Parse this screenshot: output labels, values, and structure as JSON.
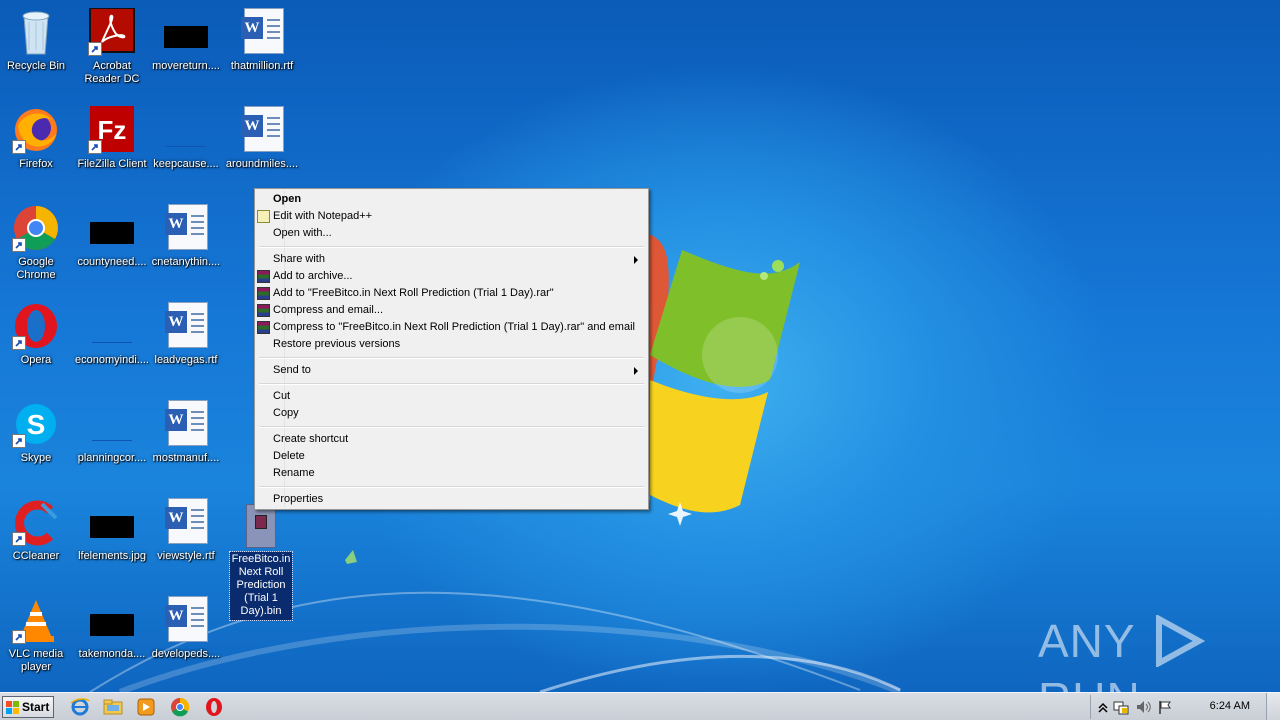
{
  "desktop": {
    "icons": [
      {
        "label": "Recycle Bin",
        "icon": "recycle-bin-icon"
      },
      {
        "label": "Acrobat\nReader DC",
        "icon": "acrobat-icon"
      },
      {
        "label": "movereturn....",
        "icon": "redacted-file-icon"
      },
      {
        "label": "thatmillion.rtf",
        "icon": "word-doc-icon"
      },
      {
        "label": "Firefox",
        "icon": "firefox-icon"
      },
      {
        "label": "FileZilla Client",
        "icon": "filezilla-icon"
      },
      {
        "label": "keepcause....",
        "icon": "blank-file-icon"
      },
      {
        "label": "aroundmiles....",
        "icon": "word-doc-icon"
      },
      {
        "label": "Google\nChrome",
        "icon": "chrome-icon"
      },
      {
        "label": "countyneed....",
        "icon": "redacted-file-icon"
      },
      {
        "label": "cnetanythin....",
        "icon": "word-doc-icon"
      },
      {
        "label": "Opera",
        "icon": "opera-icon"
      },
      {
        "label": "economyindi....",
        "icon": "blank-file-icon"
      },
      {
        "label": "leadvegas.rtf",
        "icon": "word-doc-icon"
      },
      {
        "label": "Skype",
        "icon": "skype-icon"
      },
      {
        "label": "planningcor....",
        "icon": "blank-file-icon"
      },
      {
        "label": "mostmanuf....",
        "icon": "word-doc-icon"
      },
      {
        "label": "CCleaner",
        "icon": "ccleaner-icon"
      },
      {
        "label": "lfelements.jpg",
        "icon": "redacted-file-icon"
      },
      {
        "label": "viewstyle.rtf",
        "icon": "word-doc-icon"
      },
      {
        "label": "VLC media\nplayer",
        "icon": "vlc-icon"
      },
      {
        "label": "takemonda....",
        "icon": "redacted-file-icon"
      },
      {
        "label": "developeds....",
        "icon": "word-doc-icon"
      }
    ],
    "selected_file": {
      "label": "FreeBitco.in\nNext Roll\nPrediction\n(Trial 1\nDay).bin",
      "icon": "bin-file-icon"
    }
  },
  "context_menu": {
    "open": "Open",
    "edit_notepad": "Edit with Notepad++",
    "open_with": "Open with...",
    "share_with": "Share with",
    "add_archive": "Add to archive...",
    "add_to_rar": "Add to \"FreeBitco.in Next Roll Prediction (Trial 1 Day).rar\"",
    "compress_email": "Compress and email...",
    "compress_rar_email": "Compress to \"FreeBitco.in Next Roll Prediction (Trial 1 Day).rar\" and email",
    "restore_versions": "Restore previous versions",
    "send_to": "Send to",
    "cut": "Cut",
    "copy": "Copy",
    "create_shortcut": "Create shortcut",
    "delete": "Delete",
    "rename": "Rename",
    "properties": "Properties"
  },
  "taskbar": {
    "start_label": "Start",
    "apps": [
      "internet-explorer-icon",
      "explorer-folder-icon",
      "media-player-icon",
      "chrome-icon",
      "opera-icon"
    ],
    "clock": "6:24 AM"
  },
  "watermark": {
    "left": "ANY",
    "right": "RUN"
  },
  "colors": {
    "menu_bg": "#f0f0f0",
    "selection": "#0a2c6e",
    "taskbar": "#d2d6dc"
  }
}
